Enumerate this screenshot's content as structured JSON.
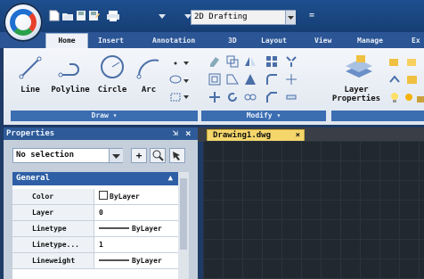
{
  "quick_access": {
    "icons": [
      "new-icon",
      "open-icon",
      "save-icon",
      "saveas-icon",
      "print-icon",
      "dropdown-arrow-icon"
    ],
    "workspace": "2D Drafting",
    "extra": "="
  },
  "tabs": [
    "Home",
    "Insert",
    "Annotation",
    "3D",
    "Layout",
    "View",
    "Manage",
    "Ex"
  ],
  "ribbon": {
    "draw": {
      "label": "Draw",
      "tools": [
        "Line",
        "Polyline",
        "Circle",
        "Arc"
      ]
    },
    "modify": {
      "label": "Modify"
    },
    "layers": {
      "label": "Layer\nProperties",
      "label_line1": "Layer",
      "label_line2": "Properties"
    }
  },
  "properties": {
    "title": "Properties",
    "pin": "⇲",
    "close": "×",
    "selection": "No selection",
    "category": "General",
    "rows": [
      {
        "key": "Color",
        "value": "ByLayer"
      },
      {
        "key": "Layer",
        "value": "0"
      },
      {
        "key": "Linetype",
        "value": "ByLayer"
      },
      {
        "key": "Linetype...",
        "value": "1"
      },
      {
        "key": "Lineweight",
        "value": "ByLayer"
      }
    ]
  },
  "document": {
    "tab": "Drawing1.dwg",
    "close": "×"
  },
  "colors": {
    "accent": "#2e5fa6",
    "doc_tab": "#f4d66b",
    "canvas": "#212830"
  }
}
